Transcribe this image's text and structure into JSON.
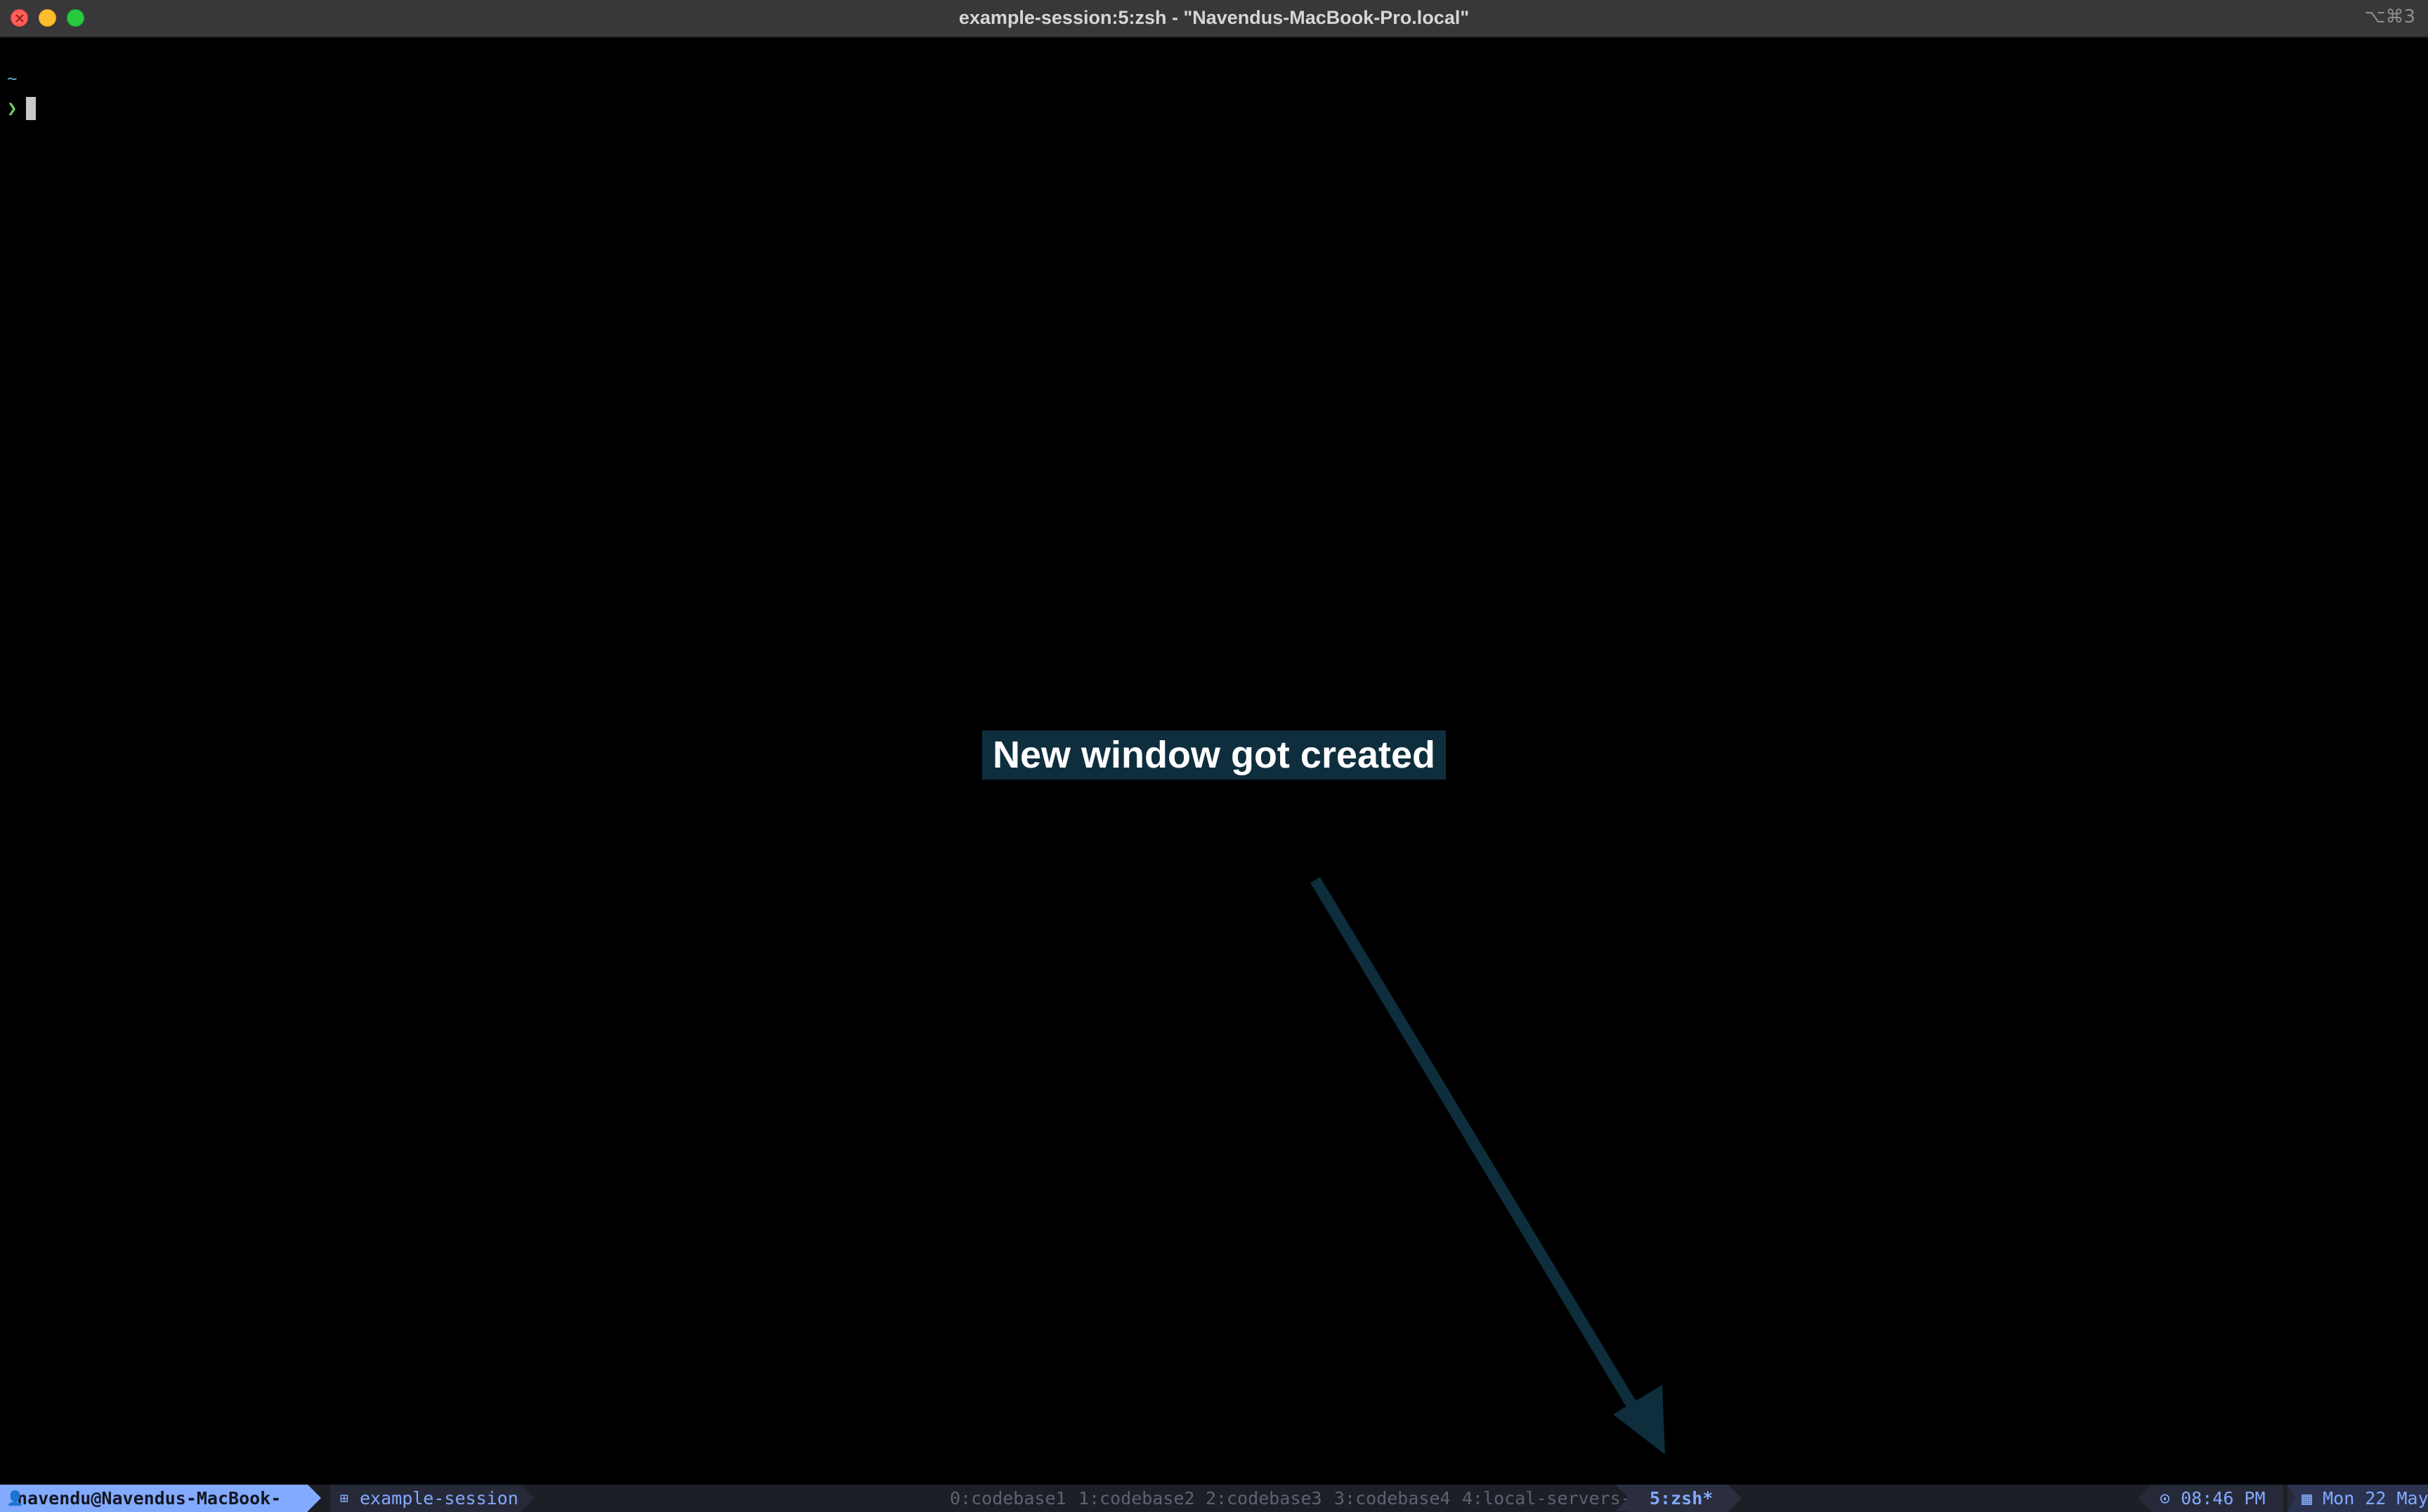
{
  "window": {
    "title": "example-session:5:zsh - \"Navendus-MacBook-Pro.local\"",
    "shortcut": "⌥⌘3"
  },
  "terminal": {
    "cwd": "~",
    "prompt_symbol": "❯"
  },
  "annotation": {
    "text": "New window got created",
    "color": "#0e2e3e"
  },
  "tmux": {
    "user_host": "navendu@Navendus-MacBook-Pro",
    "session": "example-session",
    "windows": [
      {
        "label": "0:codebase1",
        "active": false
      },
      {
        "label": "1:codebase2",
        "active": false
      },
      {
        "label": "2:codebase3",
        "active": false
      },
      {
        "label": "3:codebase4",
        "active": false
      },
      {
        "label": "4:local-servers-",
        "active": false
      },
      {
        "label": "5:zsh*",
        "active": true
      }
    ],
    "time": "08:46 PM",
    "date": "Mon 22 May",
    "user_icon": "user-icon",
    "session_icon": "grid-icon",
    "clock_icon": "clock-icon",
    "calendar_icon": "calendar-icon",
    "accent": "#82aaff"
  }
}
